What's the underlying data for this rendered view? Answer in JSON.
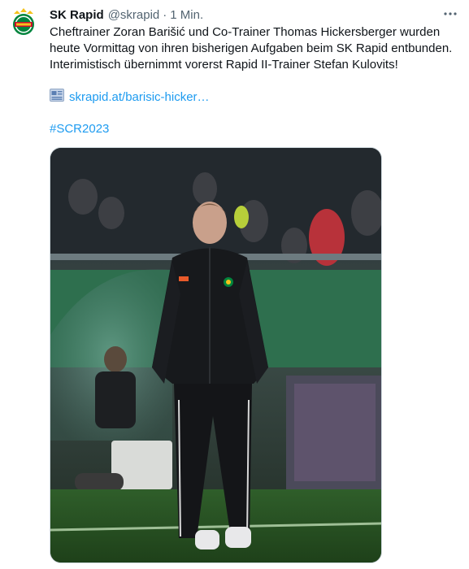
{
  "tweet": {
    "display_name": "SK Rapid",
    "handle": "@skrapid",
    "separator": "·",
    "timestamp": "1 Min.",
    "text_lines": [
      "Cheftrainer Zoran Barišić und Co-Trainer Thomas Hickersberger wurden",
      "heute Vormittag von ihren bisherigen Aufgaben beim SK Rapid entbunden.",
      "Interimistisch übernimmt vorerst Rapid II-Trainer Stefan Kulovits!"
    ],
    "link_text": "skrapid.at/barisic-hicker…",
    "hashtag": "#SCR2023",
    "more_label": "···"
  },
  "icons": {
    "avatar": "sk-rapid-crest-icon",
    "link": "article-link-icon",
    "more": "more-options-icon"
  },
  "colors": {
    "link_blue": "#1d9bf0",
    "text_primary": "#0f1419",
    "text_secondary": "#536471",
    "rapid_green": "#00843d"
  }
}
